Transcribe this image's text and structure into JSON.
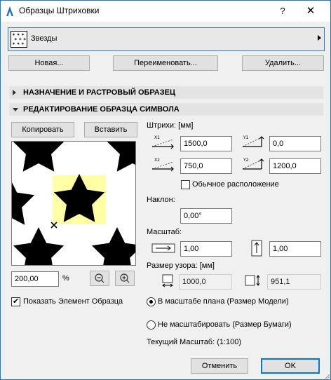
{
  "window": {
    "title": "Образцы Штриховки",
    "help": "?",
    "close": "✕"
  },
  "pattern": {
    "selected": "Звезды"
  },
  "buttons": {
    "new": "Новая...",
    "rename": "Переименовать...",
    "delete": "Удалить...",
    "copy": "Копировать",
    "paste": "Вставить",
    "cancel": "Отменить",
    "ok": "OK"
  },
  "sections": {
    "assignment": "НАЗНАЧЕНИЕ И РАСТРОВЫЙ ОБРАЗЕЦ",
    "editing": "РЕДАКТИРОВАНИЕ ОБРАЗЦА СИМВОЛА"
  },
  "hatch": {
    "heading": "Штрихи: [мм]",
    "x1": "1500,0",
    "y1": "0,0",
    "x2": "750,0",
    "y2": "1200,0",
    "icon_x1": "X1",
    "icon_y1": "Y1",
    "icon_x2": "X2",
    "icon_y2": "Y2",
    "normal_placement": "Обычное расположение",
    "normal_placement_checked": false
  },
  "slope": {
    "label": "Наклон:",
    "value": "0,00°"
  },
  "scale": {
    "label": "Масштаб:",
    "x": "1,00",
    "y": "1,00"
  },
  "pattern_size": {
    "label": "Размер узора: [мм]",
    "w": "1000,0",
    "h": "951,1"
  },
  "zoom": {
    "value": "200,00",
    "unit": "%"
  },
  "show_element": {
    "label": "Показать Элемент Образца",
    "checked": true
  },
  "scaling": {
    "plan_scale": "В масштабе плана (Размер Модели)",
    "no_scale": "Не масштабировать (Размер Бумаги)",
    "selected": "plan_scale",
    "current": "Текущий Масштаб: (1:100)"
  },
  "colors": {
    "highlight": "#ffffa6",
    "accent": "#0078d7",
    "section_bg": "#e3e3e3"
  }
}
